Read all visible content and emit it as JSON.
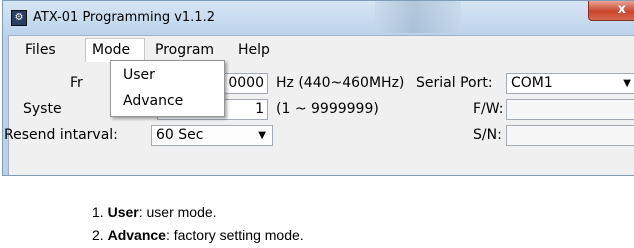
{
  "window": {
    "title": "ATX-01 Programming v1.1.2",
    "close_glyph": "x"
  },
  "menubar": {
    "files": "Files",
    "mode": "Mode",
    "program": "Program",
    "help": "Help"
  },
  "mode_menu": {
    "items": [
      "User",
      "Advance"
    ]
  },
  "form": {
    "freq_label_visible": "Fr",
    "freq_value_visible": "0000",
    "freq_hint": "Hz (440~460MHz)",
    "system_label_visible": "Syste",
    "system_value": "1",
    "system_hint": "(1 ~ 9999999)",
    "resend_label": "Resend intarval:",
    "resend_value": "60 Sec",
    "serial_label": "Serial Port:",
    "serial_value": "COM1",
    "fw_label": "F/W:",
    "sn_label": "S/N:"
  },
  "list": [
    {
      "num": "1.",
      "term": "User",
      "desc": ": user mode."
    },
    {
      "num": "2.",
      "term": "Advance",
      "desc": ": factory setting mode."
    }
  ]
}
